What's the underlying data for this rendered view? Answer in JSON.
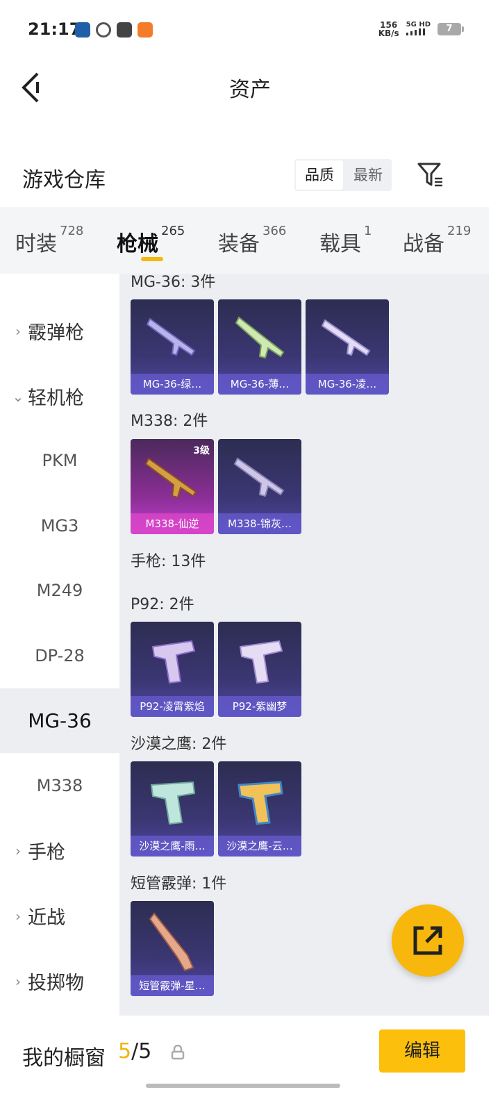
{
  "status_bar": {
    "time": "21:17",
    "speed_value": "156",
    "speed_unit": "KB/s",
    "network": "5G HD",
    "battery": "7"
  },
  "header": {
    "title": "资产",
    "back_icon": "chevron-left-icon"
  },
  "section": {
    "title": "游戏仓库",
    "sort_options": [
      "品质",
      "最新"
    ],
    "active_sort": "品质",
    "filter_icon": "filter-icon"
  },
  "tabs": [
    {
      "label": "时装",
      "count": "728"
    },
    {
      "label": "枪械",
      "count": "265",
      "active": true
    },
    {
      "label": "装备",
      "count": "366"
    },
    {
      "label": "载具",
      "count": "1"
    },
    {
      "label": "战备",
      "count": "219"
    }
  ],
  "sidebar": {
    "霰弹枪": "霰弹枪",
    "轻机枪": "轻机枪",
    "subs": [
      "PKM",
      "MG3",
      "M249",
      "DP-28",
      "MG-36",
      "M338"
    ],
    "active_sub": "MG-36",
    "手枪": "手枪",
    "近战": "近战",
    "投掷物": "投掷物"
  },
  "groups": {
    "mg36": {
      "title": "MG-36: 3件",
      "items": [
        "MG-36-绿…",
        "MG-36-薄…",
        "MG-36-凌…"
      ]
    },
    "m338": {
      "title": "M338: 2件",
      "items": [
        "M338-仙逆",
        "M338-锦灰…"
      ],
      "badge": "3级"
    },
    "pistol": {
      "title": "手枪: 13件"
    },
    "p92": {
      "title": "P92: 2件",
      "items": [
        "P92-凌霄紫焰",
        "P92-紫幽梦"
      ]
    },
    "deagle": {
      "title": "沙漠之鹰: 2件",
      "items": [
        "沙漠之鹰-雨…",
        "沙漠之鹰-云…"
      ]
    },
    "shortshotgun": {
      "title": "短管霰弹: 1件",
      "items": [
        "短管霰弹-星…"
      ]
    }
  },
  "bottom": {
    "showcase_label": "我的橱窗",
    "showcase_current": "5",
    "showcase_sep": "/",
    "showcase_total": "5",
    "edit_label": "编辑"
  },
  "colors": {
    "accent": "#f6b80c",
    "card_blue": "#3b3672",
    "card_gold": "#c03fd0"
  }
}
